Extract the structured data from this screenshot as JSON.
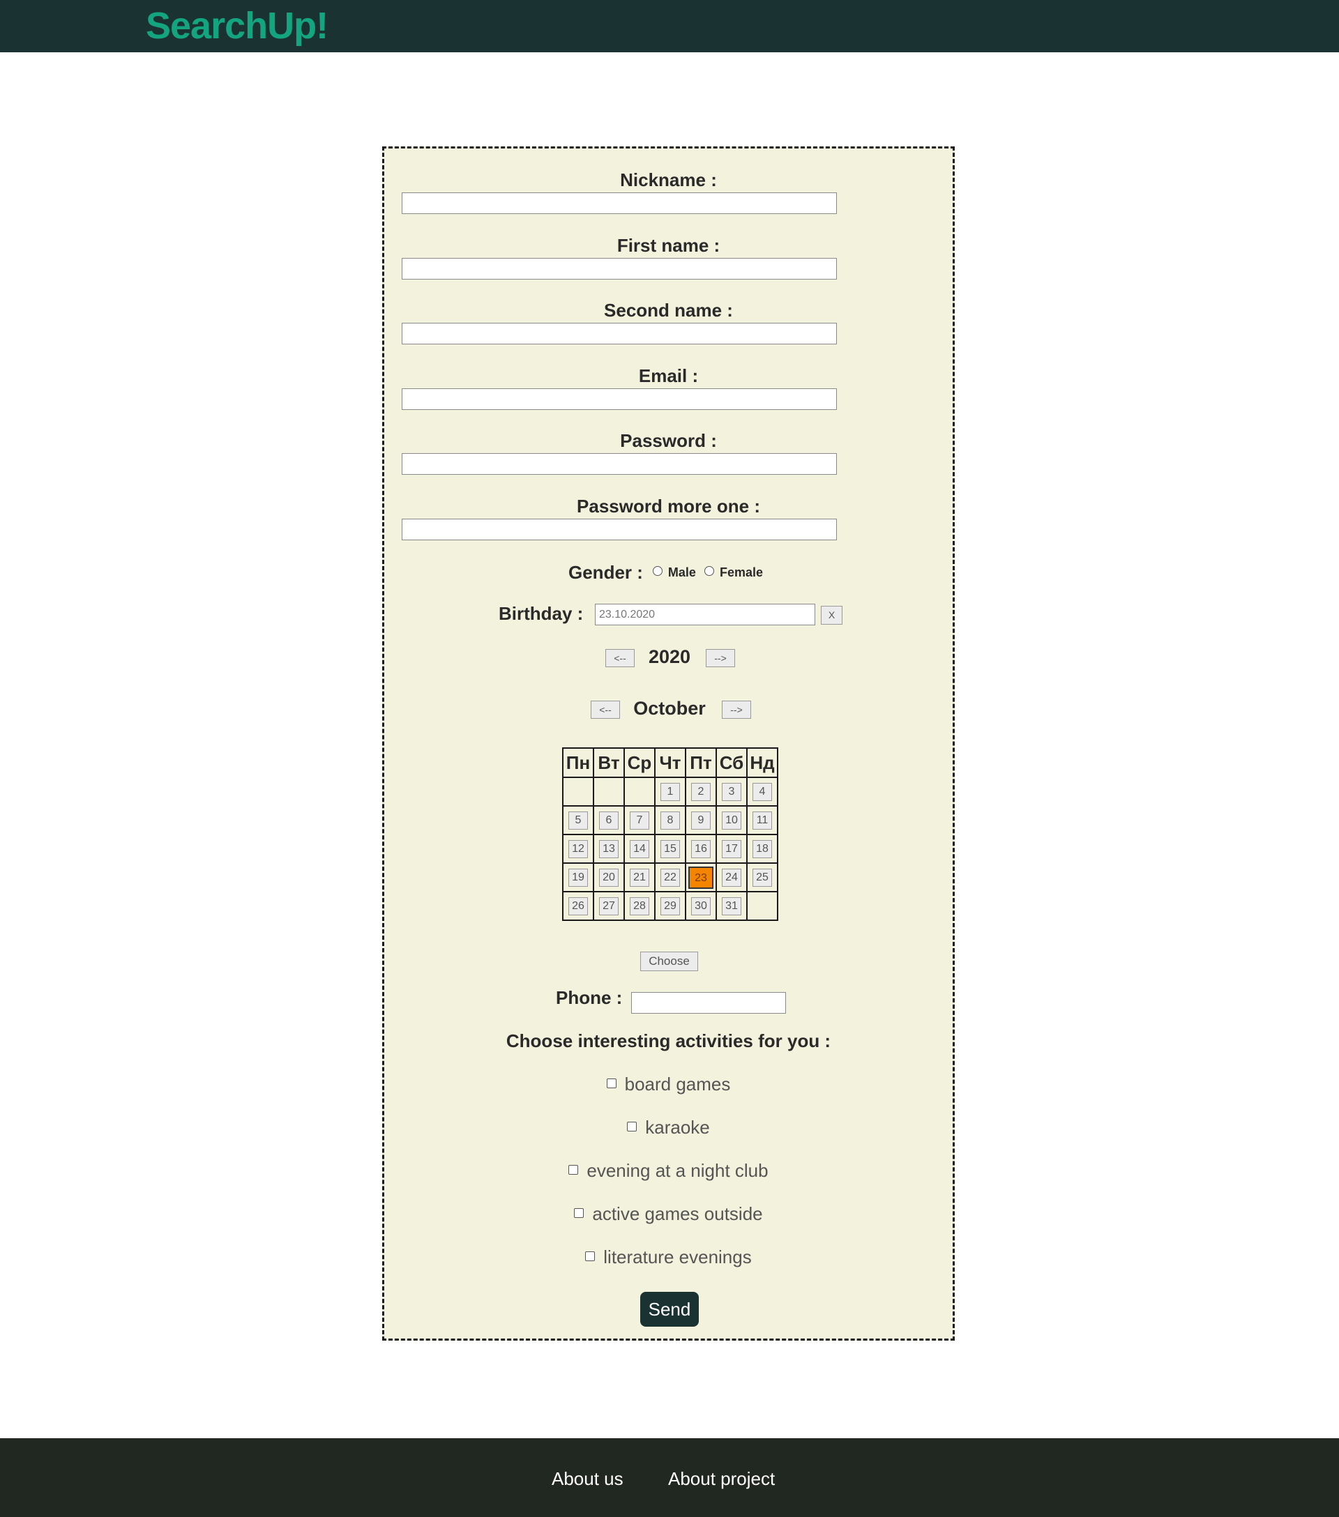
{
  "header": {
    "logo": "SearchUp!"
  },
  "form": {
    "fields": [
      {
        "label": "Nickname :"
      },
      {
        "label": "First name :"
      },
      {
        "label": "Second name :"
      },
      {
        "label": "Email :"
      },
      {
        "label": "Password :"
      },
      {
        "label": "Password more one :"
      }
    ],
    "gender": {
      "label": "Gender :",
      "options": [
        "Male",
        "Female"
      ]
    },
    "birthday": {
      "label": "Birthday :",
      "value": "23.10.2020",
      "clear_label": "X"
    },
    "year_nav": {
      "prev": "<--",
      "value": "2020",
      "next": "-->"
    },
    "month_nav": {
      "prev": "<--",
      "value": "October",
      "next": "-->"
    },
    "calendar": {
      "weekdays": [
        "Пн",
        "Вт",
        "Ср",
        "Чт",
        "Пт",
        "Сб",
        "Нд"
      ],
      "weeks": [
        [
          "",
          "",
          "",
          "1",
          "2",
          "3",
          "4"
        ],
        [
          "5",
          "6",
          "7",
          "8",
          "9",
          "10",
          "11"
        ],
        [
          "12",
          "13",
          "14",
          "15",
          "16",
          "17",
          "18"
        ],
        [
          "19",
          "20",
          "21",
          "22",
          "23",
          "24",
          "25"
        ],
        [
          "26",
          "27",
          "28",
          "29",
          "30",
          "31",
          ""
        ]
      ],
      "selected_day": "23",
      "selected_color": "#f58500"
    },
    "choose_label": "Choose",
    "phone": {
      "label": "Phone :",
      "value": ""
    },
    "activities": {
      "title": "Choose interesting activities for you :",
      "items": [
        "board games",
        "karaoke",
        "evening at a night club",
        "active games outside",
        "literature evenings"
      ]
    },
    "send_label": "Send"
  },
  "footer": {
    "links": [
      "About us",
      "About project"
    ]
  },
  "colors": {
    "header_bg": "#1b3233",
    "logo": "#13a57f",
    "form_bg": "#f3f2dc",
    "footer_bg": "#212721"
  }
}
